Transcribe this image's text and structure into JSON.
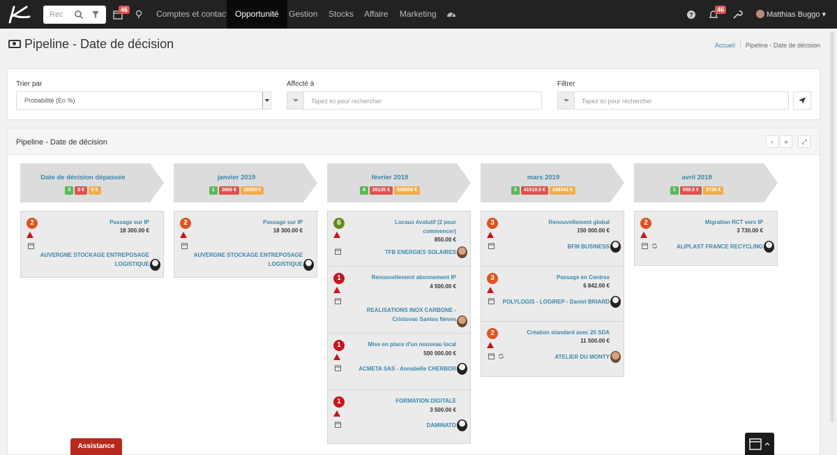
{
  "topnav": {
    "search_placeholder": "Rec",
    "calendar_badge": "46",
    "menu": [
      "Comptes et contacts",
      "Opportunité",
      "Gestion",
      "Stocks",
      "Affaire",
      "Marketing"
    ],
    "active_menu": "Opportunité",
    "notif_badge": "46",
    "user_name": "Matthias Buggo"
  },
  "page": {
    "title": "Pipeline - Date de décision",
    "breadcrumb_home": "Accueil",
    "breadcrumb_current": "Pipeline - Date de décision"
  },
  "filters": {
    "sort_label": "Trier par",
    "sort_value": "Probabilité (En %)",
    "assigned_label": "Affecté à",
    "assigned_placeholder": "Tapez ici pour rechercher",
    "filter_label": "Filtrer",
    "filter_placeholder": "Tapez ici pour rechercher"
  },
  "pipeline": {
    "title": "Pipeline - Date de décision",
    "columns": [
      {
        "title": "Date de décision dépassée",
        "count": "0",
        "red": "0 €",
        "orange": "0 €",
        "cards": [
          {
            "num": "2",
            "title": "Passage sur IP",
            "amount": "18 300.00 €",
            "company": "AUVERGNE STOCKAGE ENTREPOSAGE LOGISTIQUE"
          }
        ]
      },
      {
        "title": "janvier 2019",
        "count": "1",
        "red": "3660 €",
        "orange": "18300 €",
        "cards": [
          {
            "num": "2",
            "title": "Passage sur IP",
            "amount": "18 300.00 €",
            "company": "AUVERGNE STOCKAGE ENTREPOSAGE LOGISTIQUE"
          }
        ]
      },
      {
        "title": "février 2019",
        "count": "4",
        "red": "26135 €",
        "orange": "508850 €",
        "cards": [
          {
            "num": "6",
            "title": "Locaux évolutif (2 pour commencer)",
            "amount": "850.00 €",
            "company": "TFB ENERGIES SOLAIRES"
          },
          {
            "num": "1",
            "title": "Renouvellement abonnement IP",
            "amount": "4 500.00 €",
            "company": "REALISATIONS INOX CARBONE - Cristovao Santos Neves"
          },
          {
            "num": "1",
            "title": "Mise en place d'un nouveau local",
            "amount": "500 000.00 €",
            "company": "ACMETA SAS - Annabelle CHERBOR"
          },
          {
            "num": "1",
            "title": "FORMATION DIGITALE",
            "amount": "3 500.00 €",
            "company": "DAMINATO"
          }
        ]
      },
      {
        "title": "mars 2019",
        "count": "3",
        "red": "41510.5 €",
        "orange": "168342 €",
        "cards": [
          {
            "num": "3",
            "title": "Renouvellement global",
            "amount": "150 000.00 €",
            "company": "BFM BUSINESS"
          },
          {
            "num": "3",
            "title": "Passage en Centrex",
            "amount": "6 842.00 €",
            "company": "POLYLOGIS - LOGIREP - Daniel BRIARD"
          },
          {
            "num": "2",
            "title": "Création standard avec 20 SDA",
            "amount": "11 500.00 €",
            "company": "ATELIER DU MONTY"
          }
        ]
      },
      {
        "title": "avril 2019",
        "count": "1",
        "red": "559.5 €",
        "orange": "3730 €",
        "cards": [
          {
            "num": "2",
            "title": "Migration RCT vers IP",
            "amount": "3 730.00 €",
            "company": "ALIPLAST FRANCE RECYCLING"
          }
        ]
      }
    ]
  },
  "footer": {
    "assist_label": "Assistance"
  },
  "colors": {
    "badge_green": "#5cb85c",
    "badge_red": "#d9534f",
    "badge_orange": "#f0ad4e",
    "num_orange": "#e0531f",
    "num_red": "#c4161c",
    "num_olive": "#6a8a1f",
    "link_blue": "#3a87ad"
  }
}
